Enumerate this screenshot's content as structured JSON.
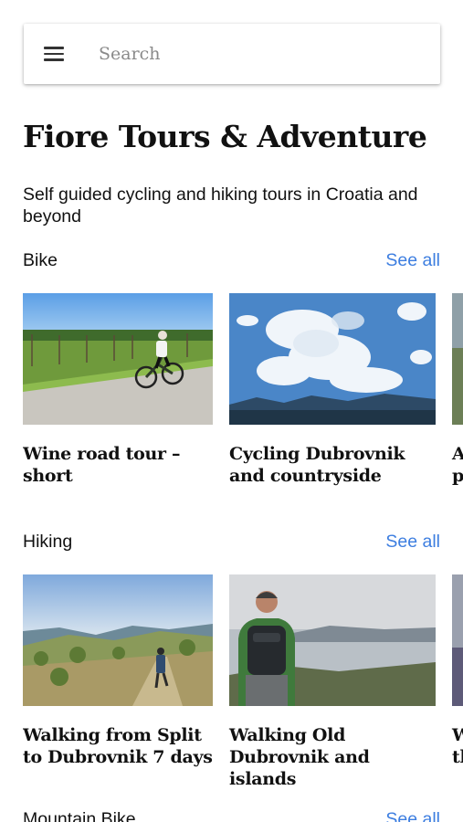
{
  "search": {
    "placeholder": "Search"
  },
  "header": {
    "title": "Fiore Tours & Adventure",
    "subtitle": "Self guided cycling and hiking tours in Croatia and beyond"
  },
  "sections": [
    {
      "title": "Bike",
      "see_all": "See all",
      "cards": [
        {
          "title": "Wine road tour – short",
          "image": "cyclist-vineyard-road-photo"
        },
        {
          "title": "Cycling Dubrovnik and countryside",
          "image": "cloudy-sky-mountains-photo"
        },
        {
          "title": "A\np",
          "image": "partial-photo"
        }
      ]
    },
    {
      "title": "Hiking",
      "see_all": "See all",
      "cards": [
        {
          "title": "Walking from Split to Dubrovnik 7 days",
          "image": "hiker-trail-photo"
        },
        {
          "title": "Walking Old Dubrovnik and islands",
          "image": "hiker-backpack-sea-photo"
        },
        {
          "title": "W\nth",
          "image": "partial-photo"
        }
      ]
    },
    {
      "title": "Mountain Bike",
      "see_all": "See all"
    }
  ],
  "colors": {
    "link": "#3d7ee0",
    "text": "#111111"
  }
}
